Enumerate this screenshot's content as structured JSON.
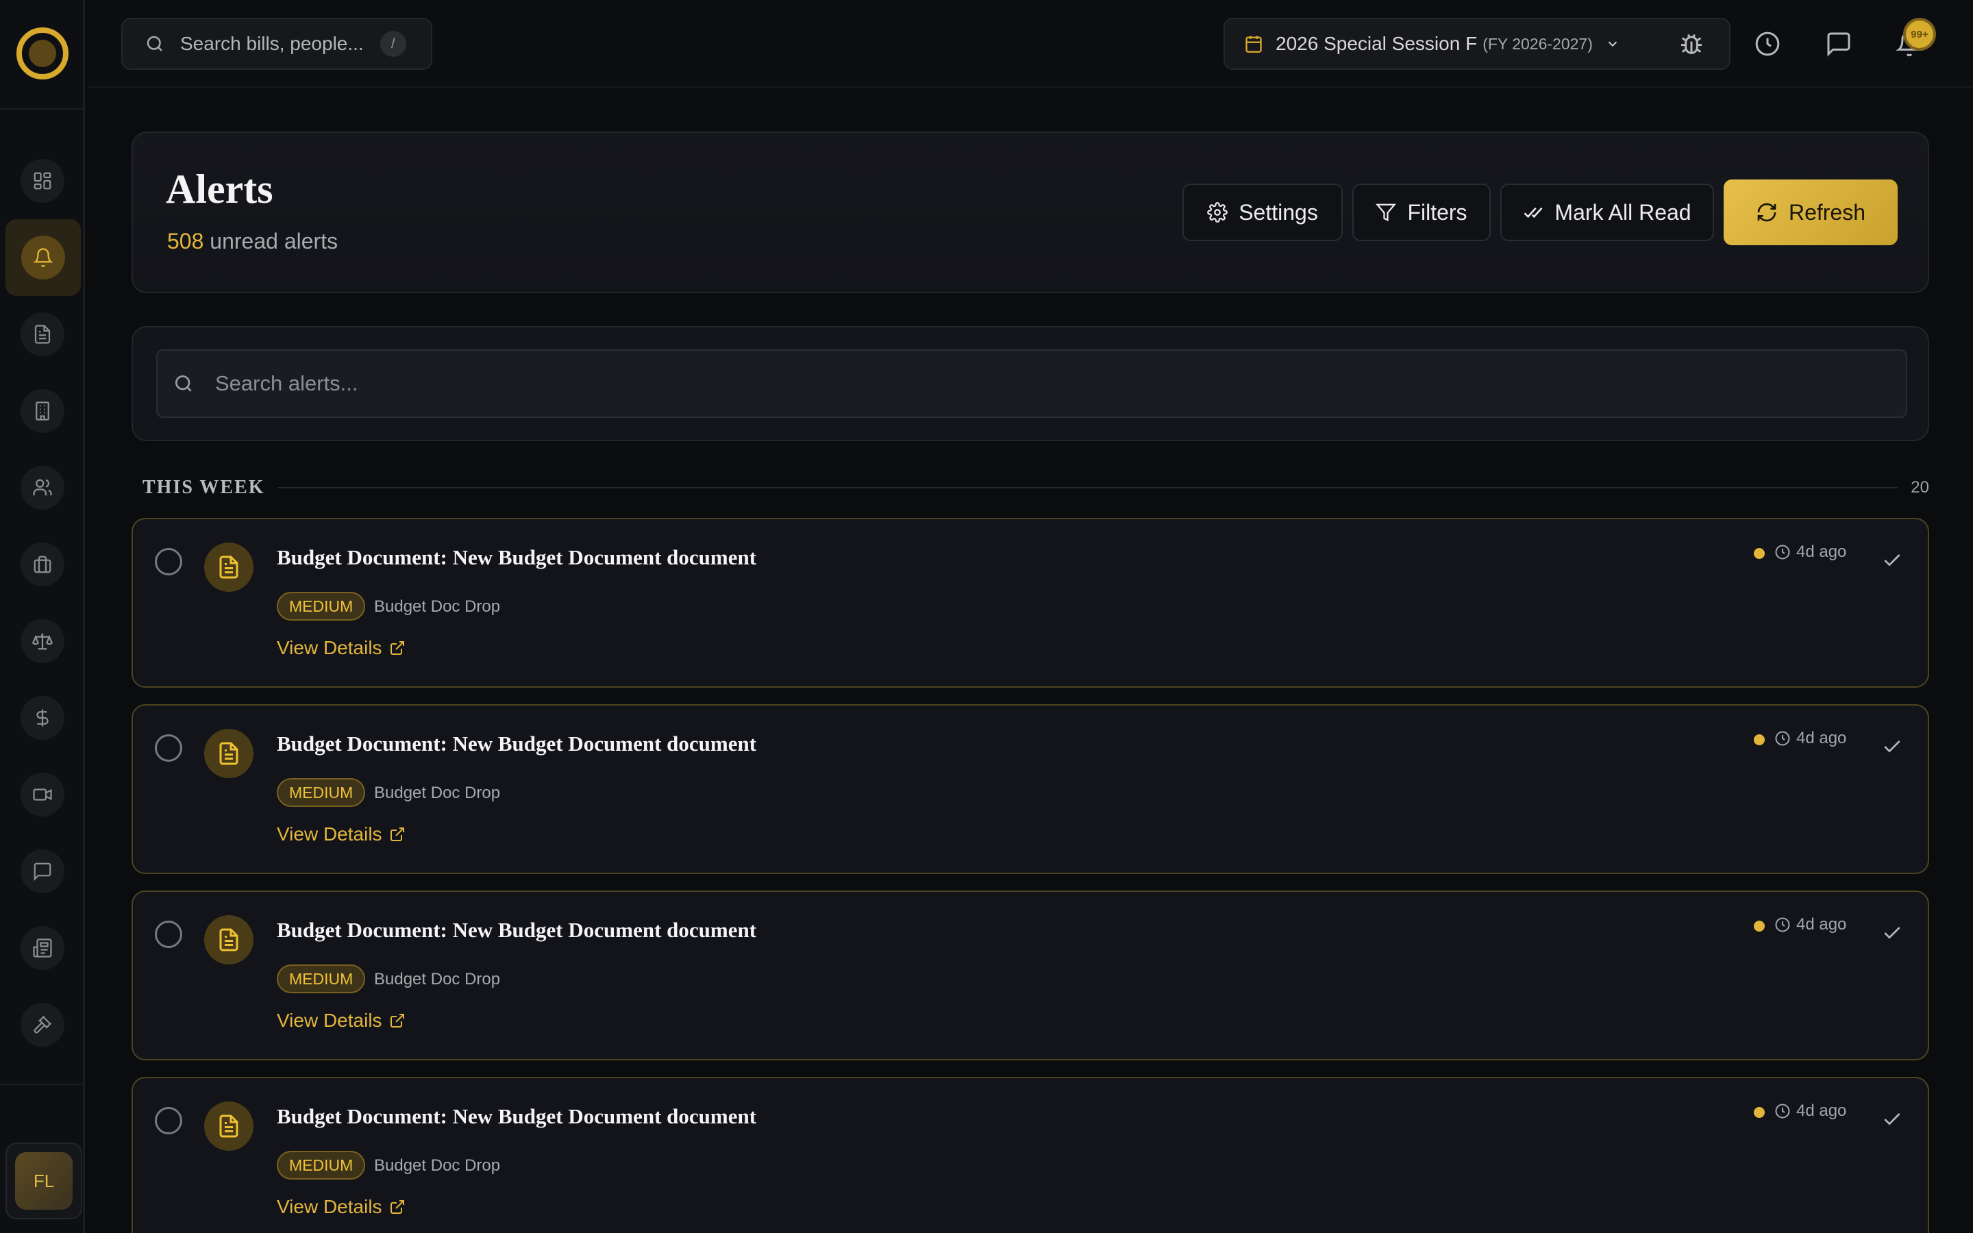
{
  "topbar": {
    "search_placeholder": "Search bills, people...",
    "search_shortcut": "/",
    "session_label": "2026 Special Session F",
    "session_fy": "(FY 2026-2027)",
    "notification_count": "99+"
  },
  "sidebar": {
    "items": [
      {
        "icon": "dashboard-icon"
      },
      {
        "icon": "bell-icon",
        "active": true
      },
      {
        "icon": "document-icon"
      },
      {
        "icon": "building-icon"
      },
      {
        "icon": "users-icon"
      },
      {
        "icon": "briefcase-icon"
      },
      {
        "icon": "scale-icon"
      },
      {
        "icon": "dollar-icon"
      },
      {
        "icon": "video-icon"
      },
      {
        "icon": "message-icon"
      },
      {
        "icon": "newspaper-icon"
      },
      {
        "icon": "gavel-icon"
      }
    ],
    "user_initials": "FL"
  },
  "header": {
    "title": "Alerts",
    "unread_count": "508",
    "unread_suffix": "unread alerts",
    "buttons": {
      "settings": "Settings",
      "filters": "Filters",
      "mark_all_read": "Mark All Read",
      "refresh": "Refresh"
    }
  },
  "alert_search": {
    "placeholder": "Search alerts..."
  },
  "section": {
    "title": "THIS WEEK",
    "count": "20"
  },
  "alerts": [
    {
      "title": "Budget Document: New Budget Document document",
      "severity": "MEDIUM",
      "source": "Budget Doc Drop",
      "link": "View Details",
      "time": "4d ago"
    },
    {
      "title": "Budget Document: New Budget Document document",
      "severity": "MEDIUM",
      "source": "Budget Doc Drop",
      "link": "View Details",
      "time": "4d ago"
    },
    {
      "title": "Budget Document: New Budget Document document",
      "severity": "MEDIUM",
      "source": "Budget Doc Drop",
      "link": "View Details",
      "time": "4d ago"
    },
    {
      "title": "Budget Document: New Budget Document document",
      "severity": "MEDIUM",
      "source": "Budget Doc Drop",
      "link": "View Details",
      "time": "4d ago"
    }
  ],
  "colors": {
    "accent": "#e2b53c",
    "background": "#0b0c0e",
    "card": "#14151a"
  }
}
